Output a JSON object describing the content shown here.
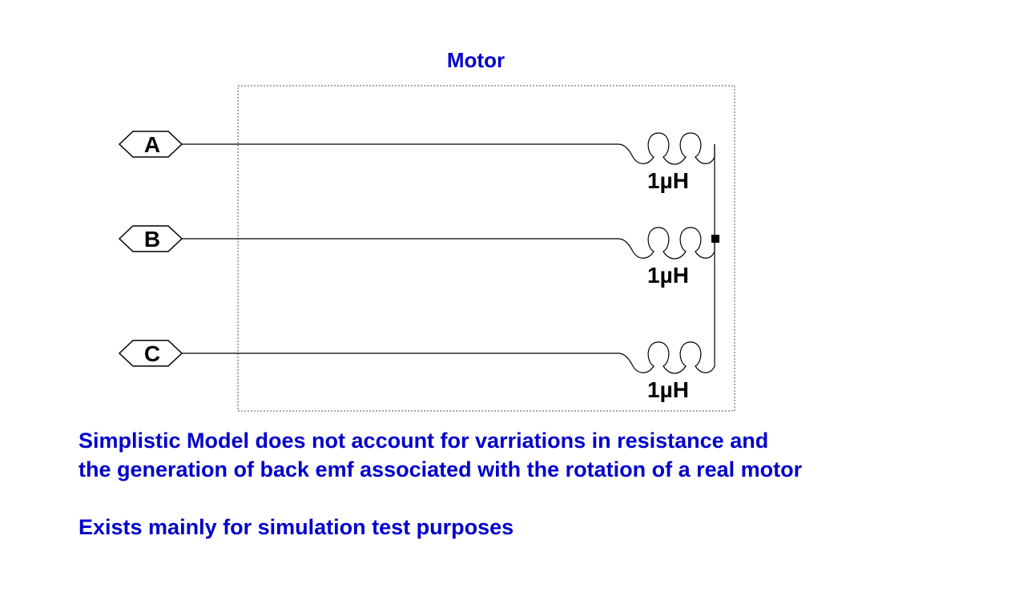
{
  "colors": {
    "wire": "#000000",
    "label_text": "#0000cc",
    "boundary": "#555555"
  },
  "diagram": {
    "title": "Motor",
    "ports": [
      {
        "id": "port-a",
        "label": "A"
      },
      {
        "id": "port-b",
        "label": "B"
      },
      {
        "id": "port-c",
        "label": "C"
      }
    ],
    "inductors": [
      {
        "id": "inductor-a",
        "value": "1µH"
      },
      {
        "id": "inductor-b",
        "value": "1µH"
      },
      {
        "id": "inductor-c",
        "value": "1µH"
      }
    ]
  },
  "notes": {
    "line1": "Simplistic Model does not account for varriations in resistance and",
    "line2": "the generation of back emf associated with the rotation of a real motor",
    "line3": "Exists mainly for simulation test purposes"
  }
}
